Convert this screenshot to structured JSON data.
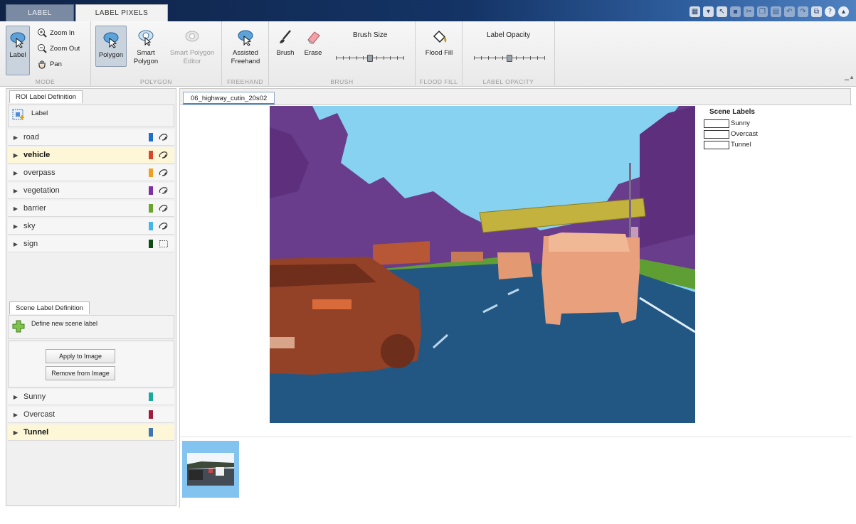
{
  "tabs": {
    "label": "LABEL",
    "label_pixels": "LABEL PIXELS"
  },
  "ribbon": {
    "mode": {
      "title": "MODE",
      "label_button": "Label",
      "zoom_in": "Zoom In",
      "zoom_out": "Zoom Out",
      "pan": "Pan"
    },
    "polygon": {
      "title": "POLYGON",
      "polygon": "Polygon",
      "smart_polygon": "Smart Polygon",
      "smart_polygon_editor": "Smart Polygon Editor"
    },
    "freehand": {
      "title": "FREEHAND",
      "assisted_freehand": "Assisted Freehand"
    },
    "brush": {
      "title": "BRUSH",
      "brush": "Brush",
      "erase": "Erase",
      "brush_size_label": "Brush Size",
      "brush_size_level": 0.5
    },
    "flood_fill": {
      "title": "FLOOD FILL",
      "flood_fill": "Flood Fill"
    },
    "label_opacity": {
      "title": "LABEL OPACITY",
      "label": "Label Opacity",
      "level": 0.5
    }
  },
  "roi_panel": {
    "tab": "ROI Label Definition",
    "new_label": "Label",
    "labels": [
      {
        "name": "road",
        "color": "#1f6ec9",
        "kind": "pixel"
      },
      {
        "name": "vehicle",
        "color": "#d9472b",
        "kind": "pixel",
        "selected": true
      },
      {
        "name": "overpass",
        "color": "#f0a020",
        "kind": "pixel"
      },
      {
        "name": "vegetation",
        "color": "#7e2fa3",
        "kind": "pixel"
      },
      {
        "name": "barrier",
        "color": "#6aa42c",
        "kind": "pixel"
      },
      {
        "name": "sky",
        "color": "#44b6ea",
        "kind": "pixel"
      },
      {
        "name": "sign",
        "color": "#0b4d14",
        "kind": "rectangle"
      }
    ]
  },
  "scene_panel": {
    "tab": "Scene Label Definition",
    "define": "Define new scene label",
    "apply": "Apply to Image",
    "remove": "Remove from Image",
    "labels": [
      {
        "name": "Sunny",
        "color": "#1aaa9d"
      },
      {
        "name": "Overcast",
        "color": "#a11c3b"
      },
      {
        "name": "Tunnel",
        "color": "#3f74b5",
        "selected": true
      }
    ]
  },
  "main": {
    "doc_tab": "06_highway_cutin_20s02",
    "legend_title": "Scene Labels",
    "legend_items": [
      "Sunny",
      "Overcast",
      "Tunnel"
    ]
  }
}
